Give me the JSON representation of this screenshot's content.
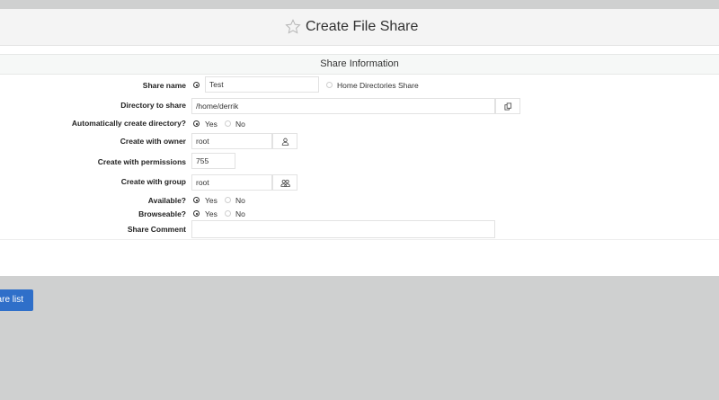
{
  "page": {
    "title": "Create File Share"
  },
  "section": {
    "title": "Share Information"
  },
  "form": {
    "share_name": {
      "label": "Share name",
      "value": "Test",
      "alt_option": "Home Directories Share"
    },
    "directory": {
      "label": "Directory to share",
      "value": "/home/derrik"
    },
    "auto_create": {
      "label": "Automatically create directory?",
      "yes": "Yes",
      "no": "No",
      "selected": "Yes"
    },
    "owner": {
      "label": "Create with owner",
      "value": "root"
    },
    "permissions": {
      "label": "Create with permissions",
      "value": "755"
    },
    "group": {
      "label": "Create with group",
      "value": "root"
    },
    "available": {
      "label": "Available?",
      "yes": "Yes",
      "no": "No",
      "selected": "Yes"
    },
    "browseable": {
      "label": "Browseable?",
      "yes": "Yes",
      "no": "No",
      "selected": "Yes"
    },
    "comment": {
      "label": "Share Comment",
      "value": ""
    }
  },
  "footer": {
    "return_button": "are list"
  },
  "colors": {
    "accent": "#2f6fc9",
    "background": "#cfd0d0",
    "panel": "#ffffff"
  }
}
